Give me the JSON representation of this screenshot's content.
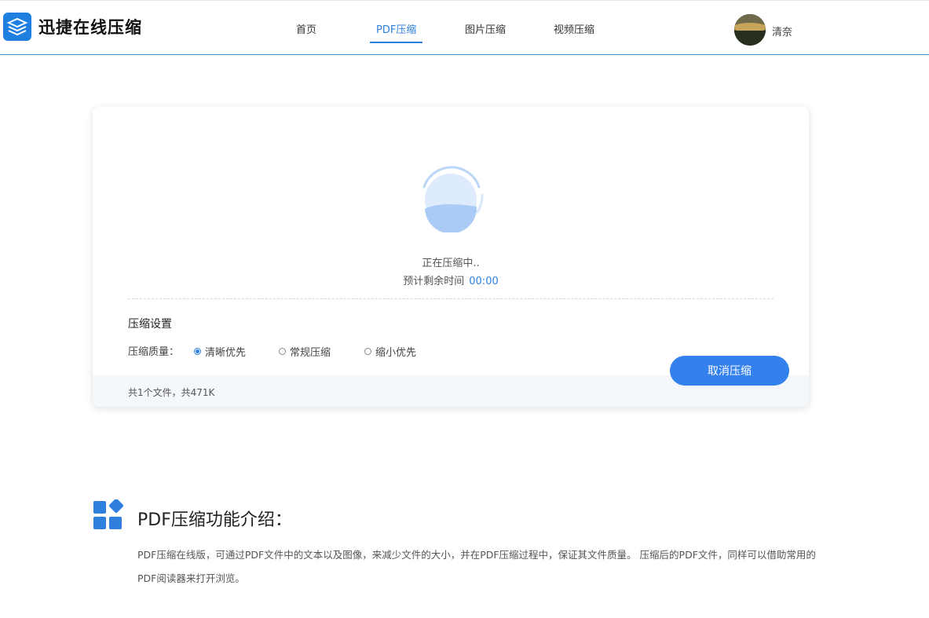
{
  "header": {
    "logo_text": "迅捷在线压缩",
    "nav": [
      {
        "label": "首页"
      },
      {
        "label": "PDF压缩"
      },
      {
        "label": "图片压缩"
      },
      {
        "label": "视频压缩"
      }
    ],
    "active_tab": "PDF压缩",
    "username": "清奈"
  },
  "progress": {
    "status": "正在压缩中..",
    "remaining_label": "预计剩余时间",
    "remaining_time": "00:00"
  },
  "settings": {
    "title": "压缩设置",
    "quality_label": "压缩质量：",
    "options": [
      {
        "label": "清晰优先",
        "checked": true
      },
      {
        "label": "常规压缩",
        "checked": false
      },
      {
        "label": "缩小优先",
        "checked": false
      }
    ]
  },
  "cancel_label": "取消压缩",
  "file_summary": "共1个文件，共471K",
  "intro": {
    "title": "PDF压缩功能介绍：",
    "text": "PDF压缩在线版，可通过PDF文件中的文本以及图像，来减少文件的大小，并在PDF压缩过程中，保证其文件质量。 压缩后的PDF文件，同样可以借助常用的PDF阅读器来打开浏览。"
  },
  "colors": {
    "accent": "#2f7fdf",
    "button": "#3381ec",
    "footer_bg": "#f4f7fb"
  }
}
